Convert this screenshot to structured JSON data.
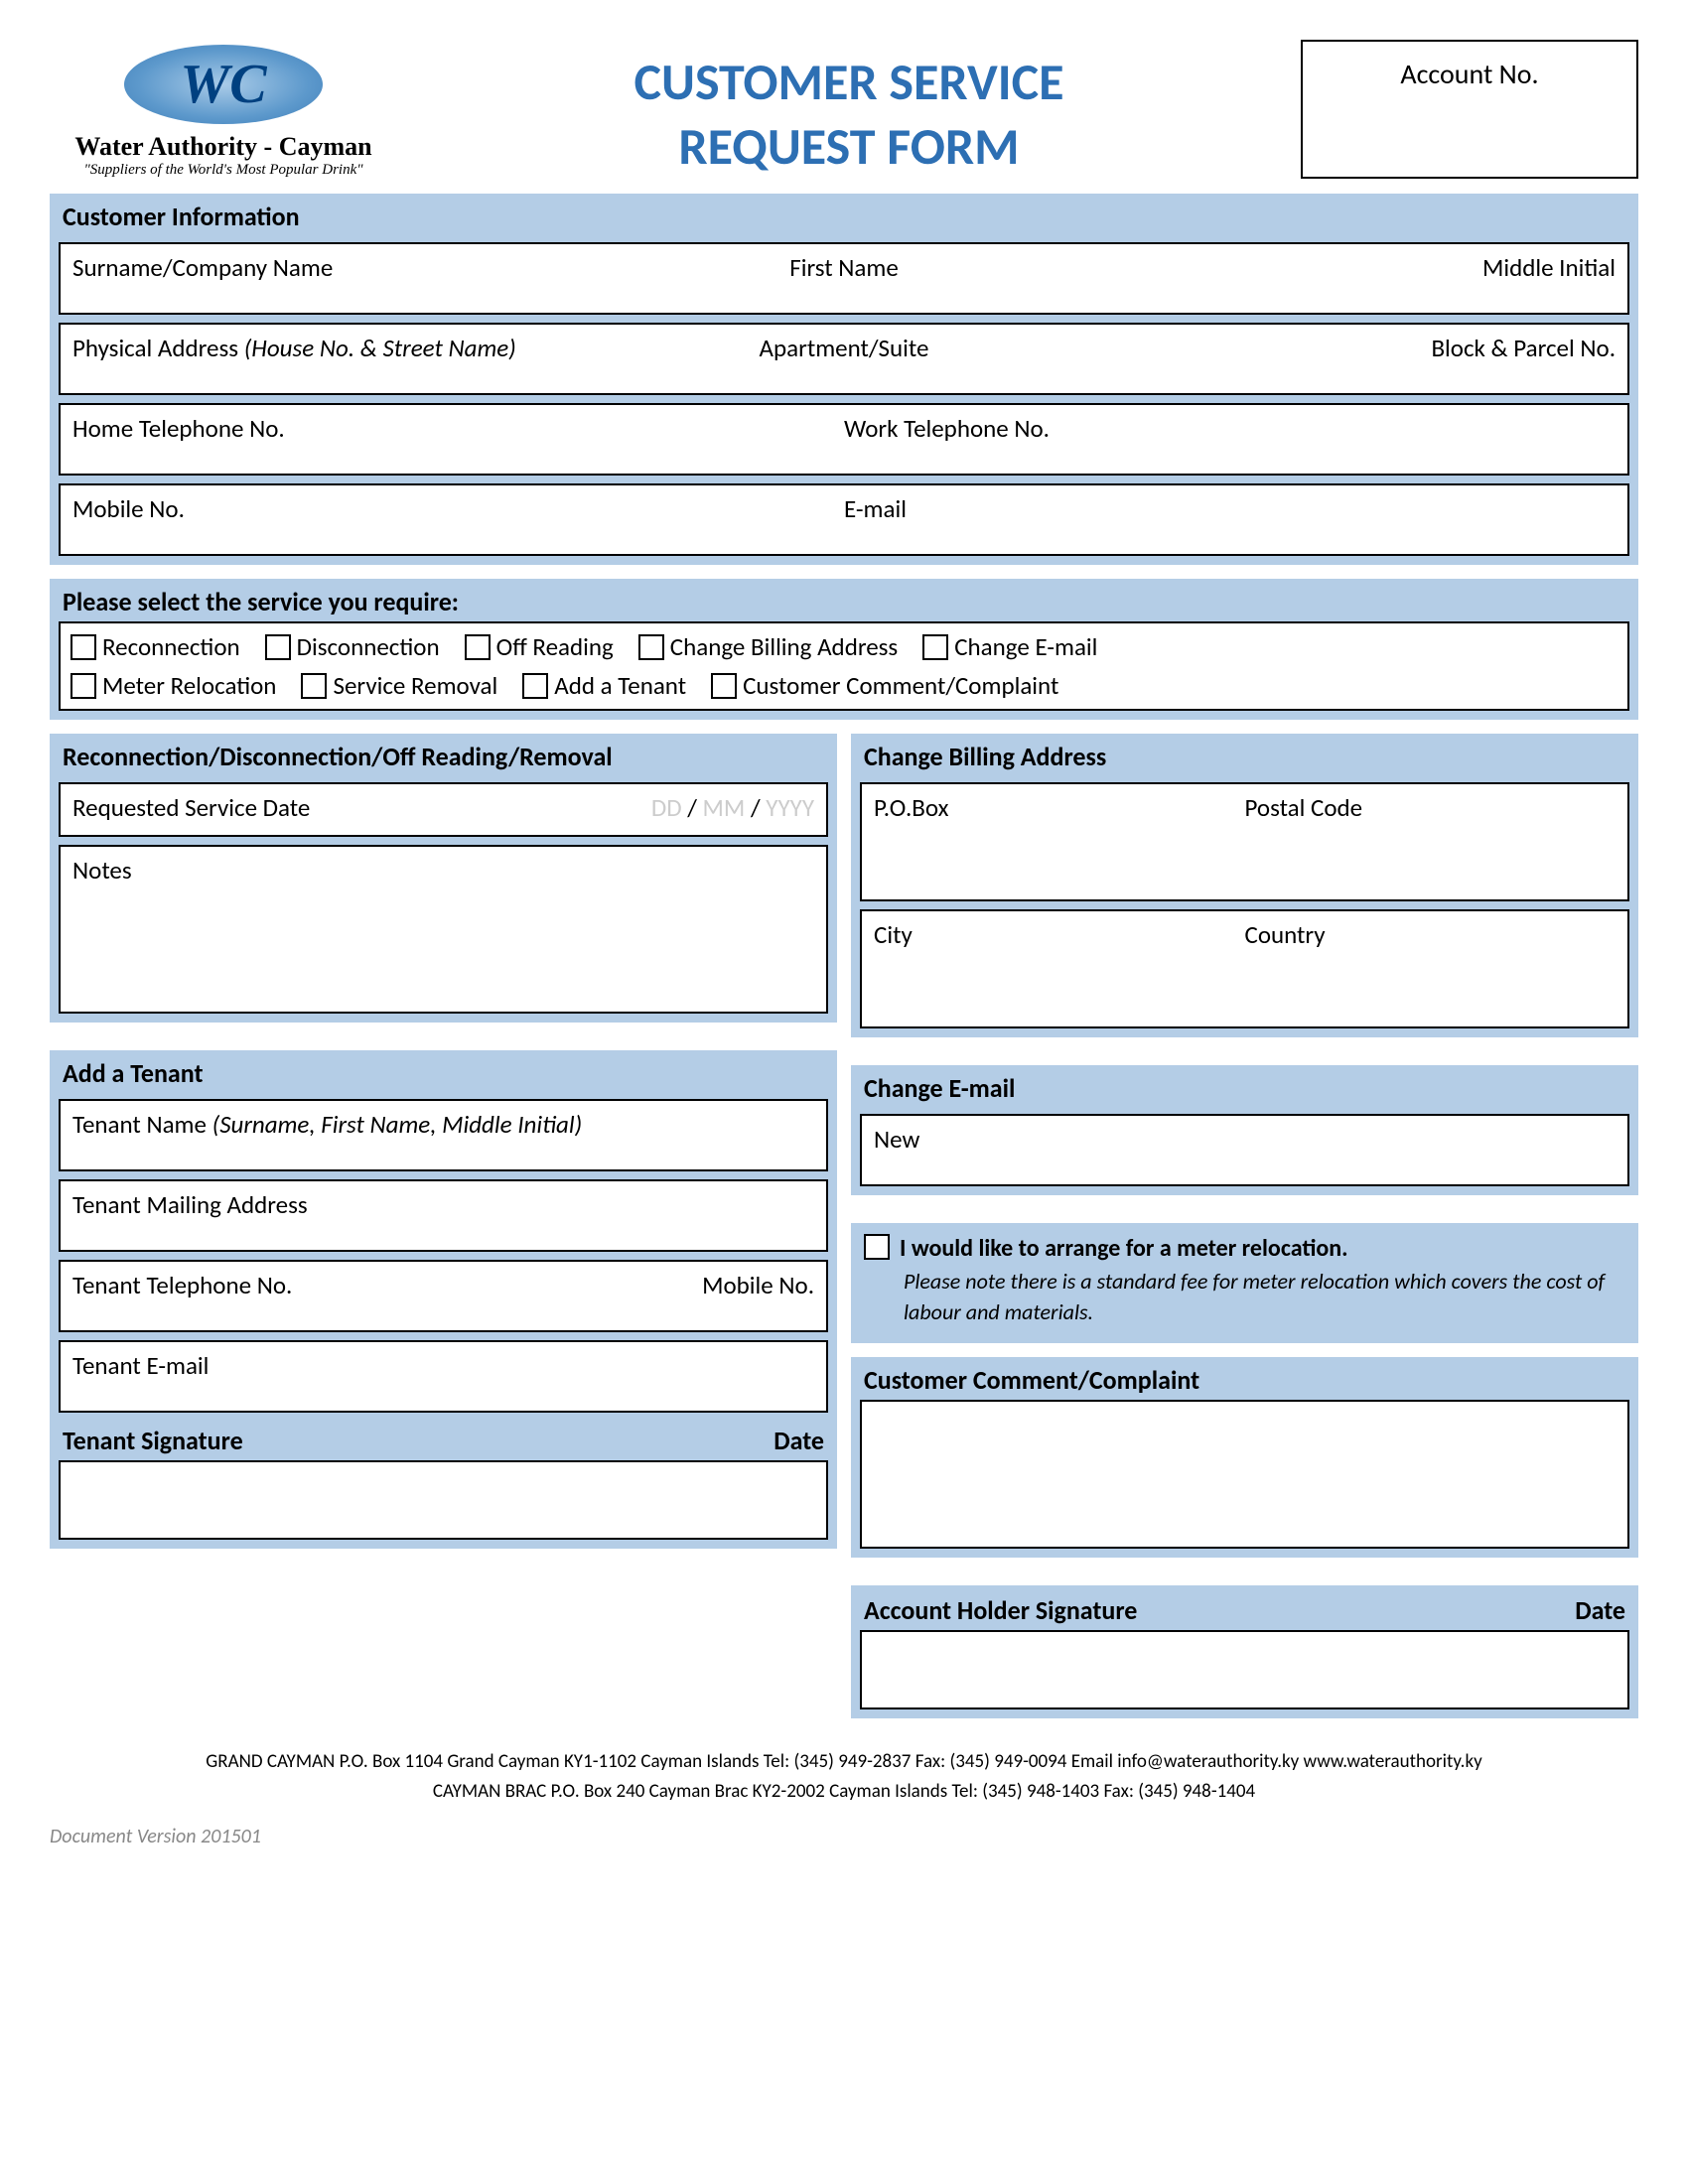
{
  "logo": {
    "initials": "WC",
    "name": "Water Authority - Cayman",
    "tagline": "\"Suppliers of the World's Most Popular Drink\""
  },
  "title": {
    "line1": "CUSTOMER SERVICE",
    "line2": "REQUEST FORM"
  },
  "accountLabel": "Account No.",
  "customerInfo": {
    "heading": "Customer Information",
    "surname": "Surname/Company Name",
    "firstName": "First Name",
    "middle": "Middle Initial",
    "addressLabel": "Physical Address ",
    "addressHint": "(House No. & Street Name)",
    "apt": "Apartment/Suite",
    "block": "Block & Parcel No.",
    "homeTel": "Home Telephone No.",
    "workTel": "Work Telephone No.",
    "mobile": "Mobile No.",
    "email": "E-mail"
  },
  "service": {
    "heading": "Please select the service you require:",
    "options": {
      "reconnection": "Reconnection",
      "disconnection": "Disconnection",
      "offReading": "Off Reading",
      "changeBilling": "Change Billing Address",
      "changeEmail": "Change E-mail",
      "meterRelocation": "Meter Relocation",
      "serviceRemoval": "Service Removal",
      "addTenant": "Add a Tenant",
      "complaint": "Customer Comment/Complaint"
    }
  },
  "svcDate": {
    "heading": "Reconnection/Disconnection/Off Reading/Removal",
    "label": "Requested Service Date",
    "dd": "DD",
    "mm": "MM",
    "yyyy": "YYYY",
    "notes": "Notes"
  },
  "tenant": {
    "heading": "Add a Tenant",
    "nameLabel": "Tenant Name ",
    "nameHint": "(Surname, First Name, Middle Initial)",
    "mailing": "Tenant Mailing Address",
    "tel": "Tenant Telephone No.",
    "mobile": "Mobile No.",
    "email": "Tenant E-mail",
    "sig": "Tenant Signature",
    "date": "Date"
  },
  "billing": {
    "heading": "Change Billing Address",
    "pobox": "P.O.Box",
    "postal": "Postal Code",
    "city": "City",
    "country": "Country"
  },
  "changeEmail": {
    "heading": "Change E-mail",
    "new": "New"
  },
  "relocation": {
    "label": "I would like to arrange for a meter relocation.",
    "note": "Please note there is a standard fee for meter relocation which covers the cost of labour and materials."
  },
  "complaint": {
    "heading": "Customer Comment/Complaint"
  },
  "accountSig": {
    "label": "Account Holder Signature",
    "date": "Date"
  },
  "footer": {
    "line1": "GRAND CAYMAN P.O. Box 1104 Grand Cayman KY1-1102 Cayman Islands Tel: (345) 949-2837 Fax: (345) 949-0094 Email info@waterauthority.ky www.waterauthority.ky",
    "line2": "CAYMAN BRAC P.O. Box 240 Cayman Brac KY2-2002 Cayman Islands Tel: (345) 948-1403 Fax: (345) 948-1404"
  },
  "version": "Document Version 201501"
}
